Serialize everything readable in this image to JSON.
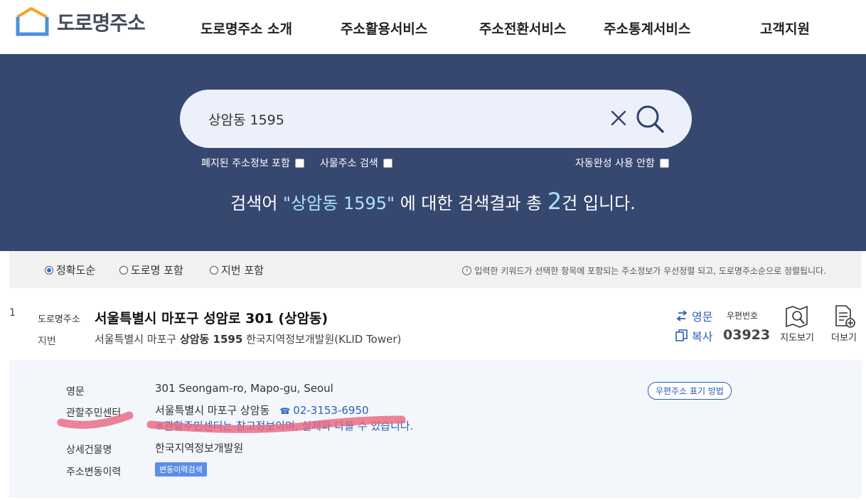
{
  "logo": {
    "text": "도로명주소",
    "color": "#4a90e2"
  },
  "nav": [
    {
      "label": "도로명주소 소개"
    },
    {
      "label": "주소활용서비스"
    },
    {
      "label": "주소전환서비스"
    },
    {
      "label": "주소통계서비스"
    },
    {
      "label": "고객지원"
    }
  ],
  "search": {
    "value": "상암동 1595",
    "options": {
      "include_abolished": "폐지된 주소정보 포함",
      "thing_address": "사물주소 검색",
      "no_autocomplete": "자동완성 사용 안함"
    },
    "result": {
      "prefix": "검색어 ",
      "keyword": "\"상암동 1595\"",
      "middle": " 에 대한 검색결과 총 ",
      "count": "2",
      "suffix": "건 입니다."
    }
  },
  "sort": {
    "options": [
      {
        "label": "정확도순",
        "selected": true
      },
      {
        "label": "도로명 포함",
        "selected": false
      },
      {
        "label": "지번 포함",
        "selected": false
      }
    ],
    "note": "입력한 키워드가 선택한 항목에 포함되는 주소정보가 우선정렬 되고, 도로명주소순으로 정렬됩니다."
  },
  "result": {
    "number": "1",
    "road_label": "도로명주소",
    "road_address": "서울특별시 마포구 성암로 301 (상암동)",
    "jibun_label": "지번",
    "jibun_prefix": "서울특별시 마포구 ",
    "jibun_bold": "상암동 1595",
    "jibun_suffix": " 한국지역정보개발원(KLID Tower)",
    "english_btn": "영문",
    "copy_btn": "복사",
    "zip_label": "우편번호",
    "zip": "03923",
    "map_btn": "지도보기",
    "more_btn": "더보기"
  },
  "detail": {
    "english_label": "영문",
    "english_value": "301 Seongam-ro, Mapo-gu, Seoul",
    "center_label": "관할주민센터",
    "center_value": "서울특별시 마포구 상암동",
    "center_tel": "02-3153-6950",
    "center_note": "※관할주민센터는 참고정보이며, 실제와 다를 수 있습니다.",
    "building_label": "상세건물명",
    "building_value": "한국지역정보개발원",
    "history_label": "주소변동이력",
    "history_btn": "변동이력검색",
    "zip_guide_btn": "우편주소 표기 방법"
  },
  "colors": {
    "hero_bg": "#364870",
    "accent": "#2d5fb4",
    "highlight_marker": "#e8657e"
  }
}
